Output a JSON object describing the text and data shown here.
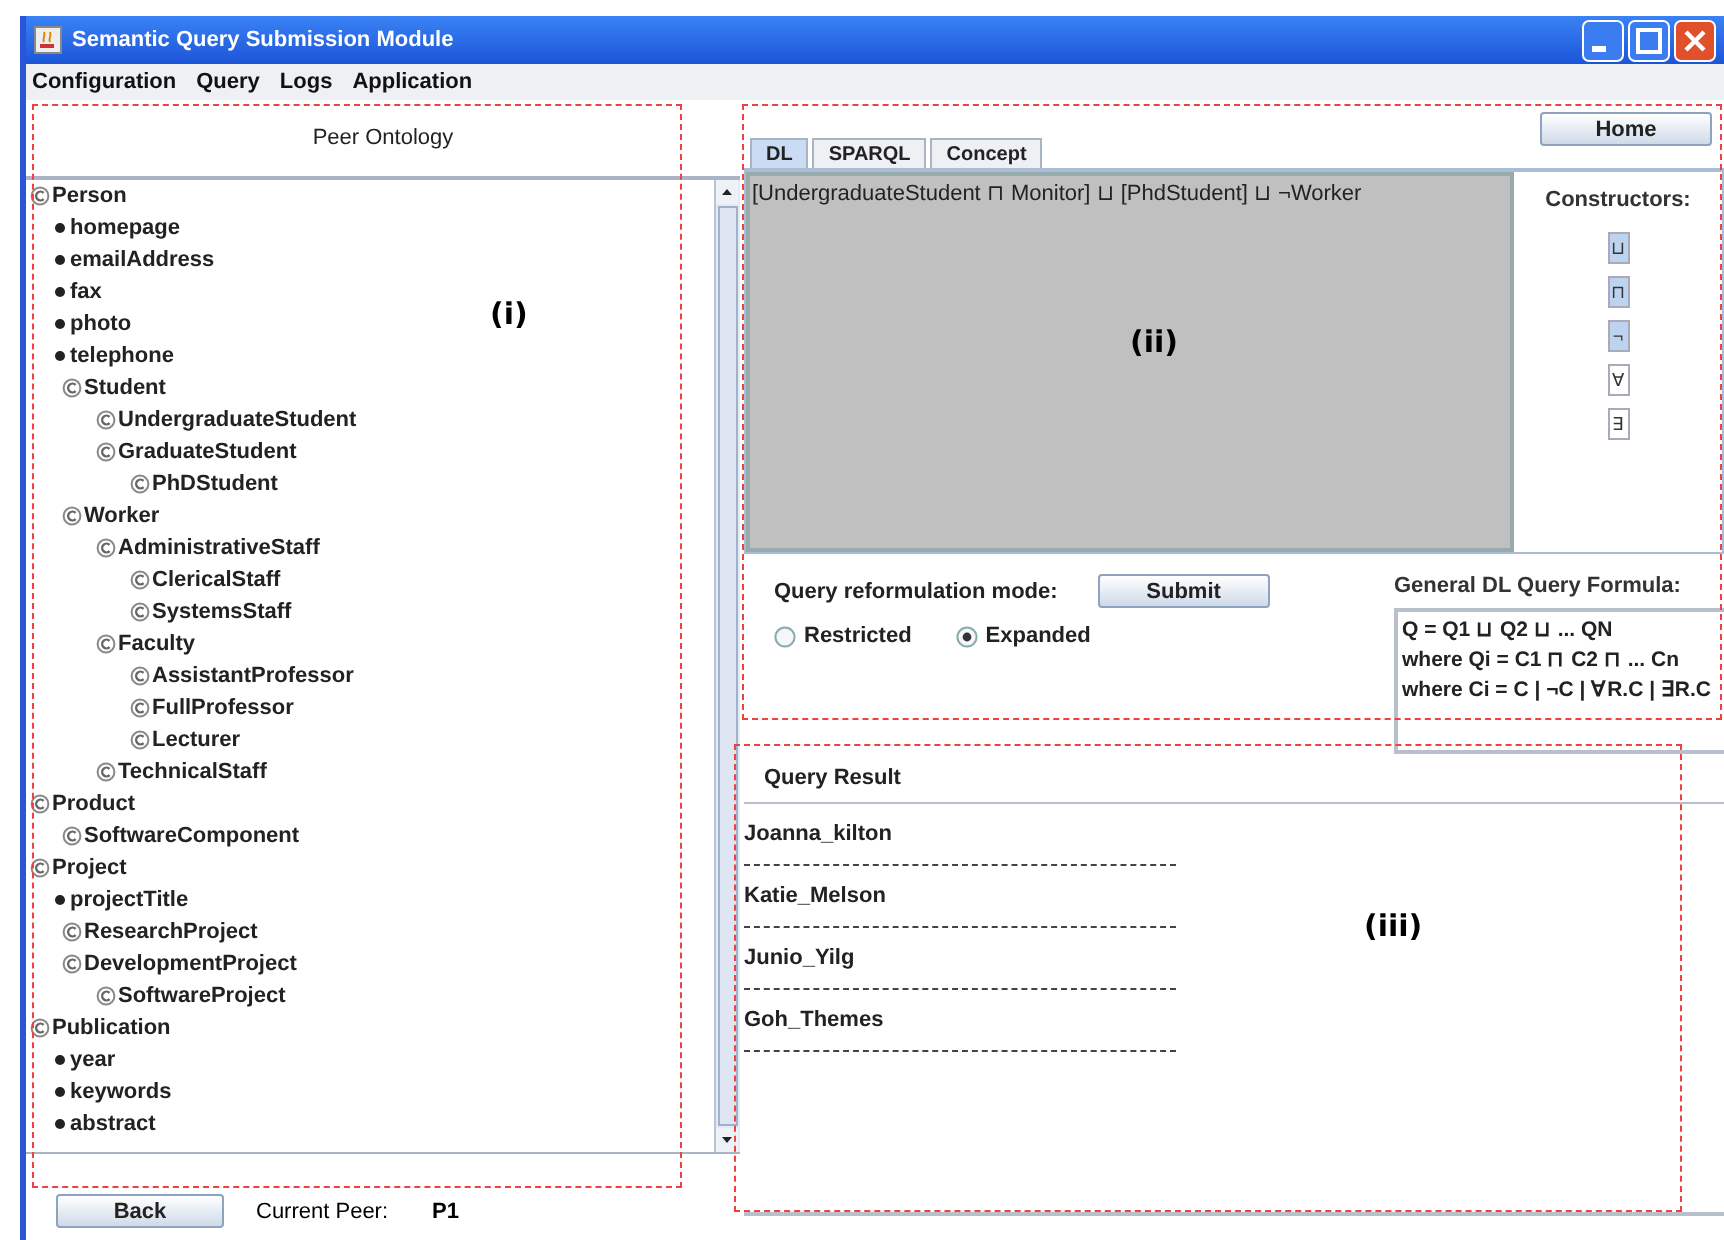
{
  "window": {
    "title": "Semantic Query Submission Module"
  },
  "menu": [
    "Configuration",
    "Query",
    "Logs",
    "Application"
  ],
  "ontology_panel": {
    "title": "Peer Ontology",
    "tree": [
      {
        "label": "Person",
        "kind": "class",
        "children": [
          {
            "label": "homepage",
            "kind": "property"
          },
          {
            "label": "emailAddress",
            "kind": "property"
          },
          {
            "label": "fax",
            "kind": "property"
          },
          {
            "label": "photo",
            "kind": "property"
          },
          {
            "label": "telephone",
            "kind": "property"
          },
          {
            "label": "Student",
            "kind": "class",
            "children": [
              {
                "label": "UndergraduateStudent",
                "kind": "class"
              },
              {
                "label": "GraduateStudent",
                "kind": "class",
                "children": [
                  {
                    "label": "PhDStudent",
                    "kind": "class"
                  }
                ]
              }
            ]
          },
          {
            "label": "Worker",
            "kind": "class",
            "children": [
              {
                "label": "AdministrativeStaff",
                "kind": "class",
                "children": [
                  {
                    "label": "ClericalStaff",
                    "kind": "class"
                  },
                  {
                    "label": "SystemsStaff",
                    "kind": "class"
                  }
                ]
              },
              {
                "label": "Faculty",
                "kind": "class",
                "children": [
                  {
                    "label": "AssistantProfessor",
                    "kind": "class"
                  },
                  {
                    "label": "FullProfessor",
                    "kind": "class"
                  },
                  {
                    "label": "Lecturer",
                    "kind": "class"
                  }
                ]
              },
              {
                "label": "TechnicalStaff",
                "kind": "class"
              }
            ]
          }
        ]
      },
      {
        "label": "Product",
        "kind": "class",
        "children": [
          {
            "label": "SoftwareComponent",
            "kind": "class"
          }
        ]
      },
      {
        "label": "Project",
        "kind": "class",
        "children": [
          {
            "label": "projectTitle",
            "kind": "property"
          },
          {
            "label": "ResearchProject",
            "kind": "class"
          },
          {
            "label": "DevelopmentProject",
            "kind": "class",
            "children": [
              {
                "label": "SoftwareProject",
                "kind": "class"
              }
            ]
          }
        ]
      },
      {
        "label": "Publication",
        "kind": "class",
        "children": [
          {
            "label": "year",
            "kind": "property"
          },
          {
            "label": "keywords",
            "kind": "property"
          },
          {
            "label": "abstract",
            "kind": "property"
          }
        ]
      }
    ]
  },
  "home_button": "Home",
  "tabs": [
    {
      "label": "DL",
      "selected": true
    },
    {
      "label": "SPARQL",
      "selected": false
    },
    {
      "label": "Concept",
      "selected": false
    }
  ],
  "query_text": "[UndergraduateStudent ⊓ Monitor] ⊔ [PhdStudent] ⊔ ¬Worker",
  "constructors": {
    "title": "Constructors:",
    "buttons": [
      {
        "label": "⊔",
        "selected": true
      },
      {
        "label": "⊓",
        "selected": true
      },
      {
        "label": "¬",
        "selected": true
      },
      {
        "label": "∀",
        "selected": false
      },
      {
        "label": "∃",
        "selected": false
      }
    ]
  },
  "reformulation": {
    "label": "Query reformulation mode:",
    "submit": "Submit",
    "options": [
      {
        "label": "Restricted",
        "selected": false
      },
      {
        "label": "Expanded",
        "selected": true
      }
    ]
  },
  "formula": {
    "title": "General DL Query Formula:",
    "lines": [
      "Q = Q1 ⊔ Q2 ⊔ ... QN",
      "where Qi = C1 ⊓ C2 ⊓ ... Cn",
      "where Ci = C | ¬C | ∀R.C | ∃R.C"
    ]
  },
  "results": {
    "title": "Query Result",
    "items": [
      "Joanna_kilton",
      "Katie_Melson",
      "Junio_Yilg",
      "Goh_Themes"
    ]
  },
  "footer": {
    "back": "Back",
    "peer_label": "Current Peer:",
    "peer_value": "P1"
  },
  "annotations": [
    "(i)",
    "(ii)",
    "(iii)"
  ]
}
